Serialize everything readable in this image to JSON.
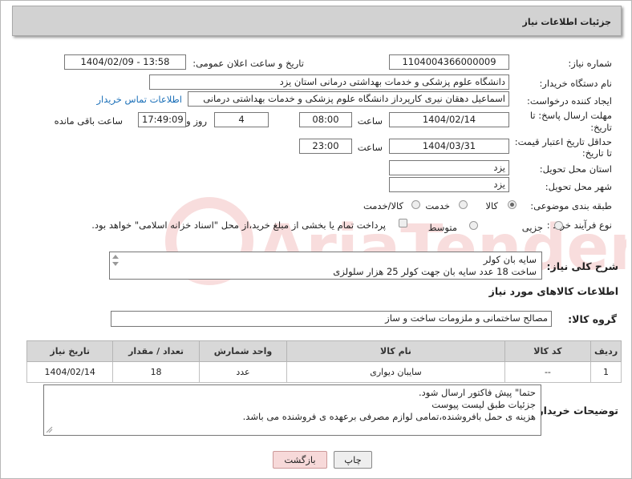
{
  "header": {
    "title": "جزئیات اطلاعات نیاز"
  },
  "fields": {
    "need_number_label": "شماره نیاز:",
    "need_number": "1104004366000009",
    "announce_label": "تاریخ و ساعت اعلان عمومی:",
    "announce_value": "1404/02/09 - 13:58",
    "buyer_org_label": "نام دستگاه خریدار:",
    "buyer_org": "دانشگاه علوم پزشکی و خدمات بهداشتی  درمانی استان یزد",
    "creator_label": "ایجاد کننده درخواست:",
    "creator": "اسماعیل دهقان نیری کارپرداز دانشگاه علوم پزشکی و خدمات بهداشتی  درمانی",
    "contact_link": "اطلاعات تماس خریدار",
    "reply_deadline_label_1": "مهلت ارسال پاسخ: تا",
    "reply_deadline_label_2": "تاریخ:",
    "reply_date": "1404/02/14",
    "time_label": "ساعت",
    "reply_time": "08:00",
    "days_value": "4",
    "days_label": "روز و",
    "remaining_time": "17:49:09",
    "remaining_label": "ساعت باقی مانده",
    "min_validity_label_1": "حداقل تاریخ اعتبار قیمت:",
    "min_validity_label_2": "تا تاریخ:",
    "validity_date": "1404/03/31",
    "validity_time": "23:00",
    "province_label": "استان محل تحویل:",
    "province": "یزد",
    "city_label": "شهر محل تحویل:",
    "city": "یزد",
    "category_label": "طبقه بندی موضوعی:",
    "category_options": [
      "کالا",
      "خدمت",
      "کالا/خدمت"
    ],
    "purchase_type_label": "نوع فرآیند خرید :",
    "purchase_options": [
      "جزیی",
      "متوسط"
    ],
    "payment_note": "پرداخت تمام یا بخشی از مبلغ خرید،از محل \"اسناد خزانه اسلامی\" خواهد بود."
  },
  "description": {
    "label": "شرح کلی نیاز:",
    "lines": [
      "سایه بان کولر",
      "ساخت 18 عدد سایه بان جهت کولر 25 هزار سلولزی"
    ]
  },
  "goods": {
    "section_title": "اطلاعات کالاهای مورد نیاز",
    "group_label": "گروه کالا:",
    "group_value": "مصالح ساختمانی و ملزومات ساخت و ساز",
    "columns": [
      "ردیف",
      "کد کالا",
      "نام کالا",
      "واحد شمارش",
      "تعداد / مقدار",
      "تاریخ نیاز"
    ],
    "rows": [
      {
        "row": "1",
        "code": "--",
        "name": "سایبان دیواری",
        "unit": "عدد",
        "qty": "18",
        "date": "1404/02/14"
      }
    ]
  },
  "buyer_notes": {
    "label": "توضیحات خریدار:",
    "lines": [
      "حتما\" پیش فاکتور ارسال شود.",
      "جزئیات طبق لیست پیوست",
      "هزینه ی حمل بافروشنده،تمامی لوازم مصرفی برعهده ی فروشنده می باشد."
    ]
  },
  "buttons": {
    "print": "چاپ",
    "back": "بازگشت"
  },
  "watermark_text": "AriaTender.neT"
}
